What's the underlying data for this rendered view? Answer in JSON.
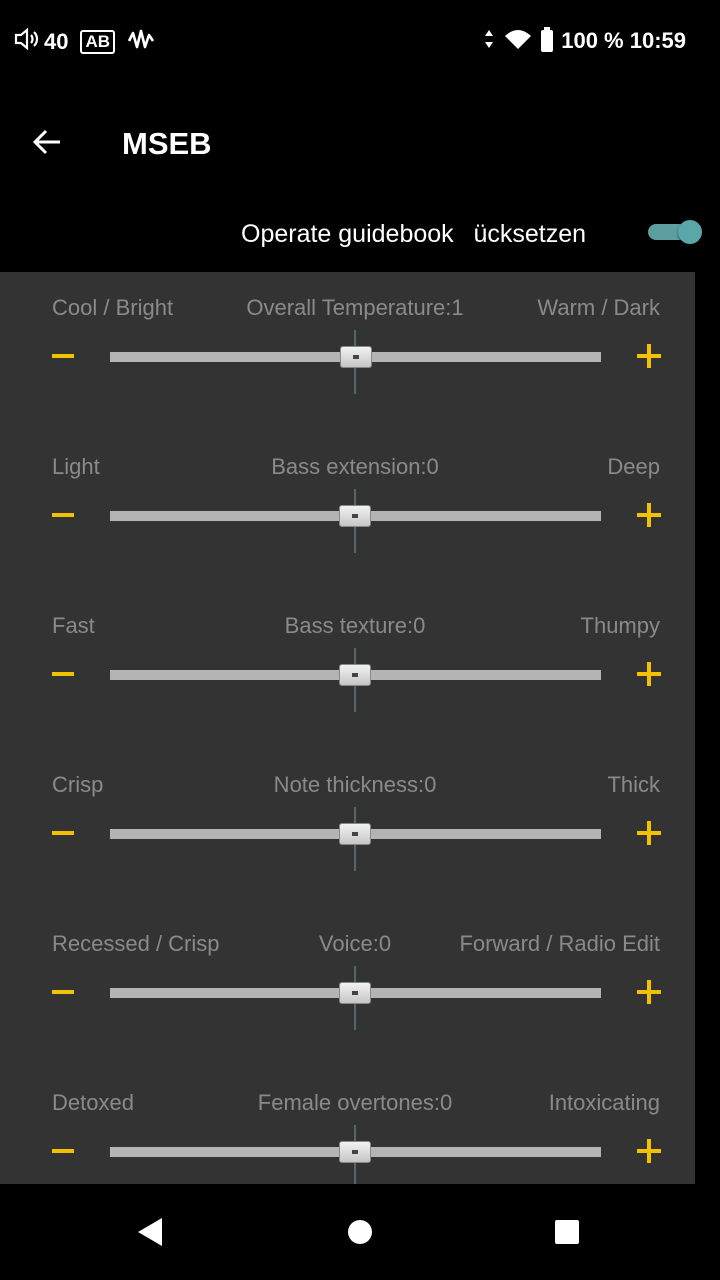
{
  "status_bar": {
    "volume": "40",
    "ab_badge": "AB",
    "battery_text": "100 % 10:59",
    "icons": [
      "volume-icon",
      "ab-badge",
      "waveform-icon",
      "data-arrows-icon",
      "wifi-icon",
      "battery-icon"
    ]
  },
  "app_bar": {
    "title": "MSEB",
    "back_icon": "arrow-left-icon"
  },
  "toolbar": {
    "guidebook_label": "Operate guidebook",
    "reset_label": "Zurücksetzen",
    "toggle_on": true,
    "accent": "#5aa7a9"
  },
  "colors": {
    "content_bg": "#333333",
    "label": "#8a8a8a",
    "accent_yellow": "#f2c200"
  },
  "sliders": [
    {
      "left": "Cool / Bright",
      "center": "Overall Temperature:1",
      "right": "Warm / Dark",
      "value": 1
    },
    {
      "left": "Light",
      "center": "Bass extension:0",
      "right": "Deep",
      "value": 0
    },
    {
      "left": "Fast",
      "center": "Bass texture:0",
      "right": "Thumpy",
      "value": 0
    },
    {
      "left": "Crisp",
      "center": "Note thickness:0",
      "right": "Thick",
      "value": 0
    },
    {
      "left": "Recessed / Crisp",
      "center": "Voice:0",
      "right": "Forward / Radio Edit",
      "value": 0
    },
    {
      "left": "Detoxed",
      "center": "Female overtones:0",
      "right": "Intoxicating",
      "value": 0
    }
  ],
  "nav_bar": {
    "icons": [
      "nav-back-icon",
      "nav-home-icon",
      "nav-recents-icon"
    ]
  }
}
